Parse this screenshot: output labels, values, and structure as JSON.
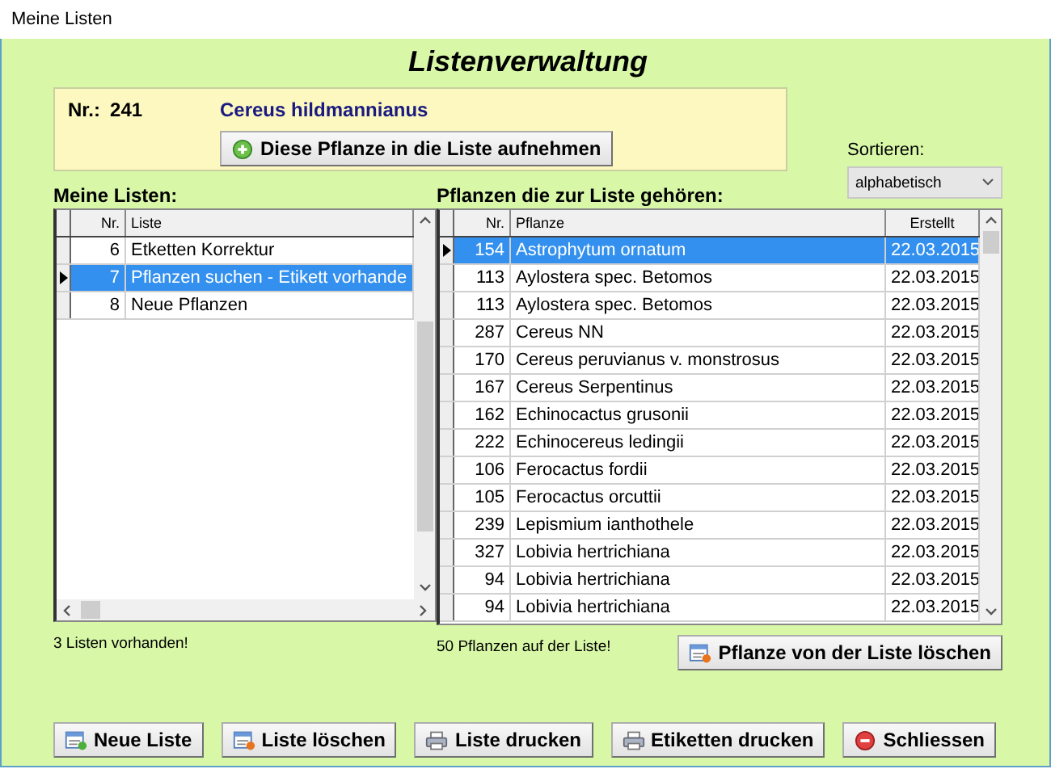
{
  "window": {
    "title": "Meine Listen"
  },
  "heading": "Listenverwaltung",
  "plant_panel": {
    "nr_label": "Nr.:",
    "nr": "241",
    "name": "Cereus hildmannianus",
    "add_button": {
      "label": "Diese Pflanze in die Liste aufnehmen",
      "kind": "add"
    }
  },
  "sort": {
    "label": "Sortieren:",
    "value": "alphabetisch"
  },
  "lists": {
    "title": "Meine Listen:",
    "columns": [
      "Nr.",
      "Liste"
    ],
    "rows": [
      {
        "nr": "6",
        "name": "Etketten Korrektur",
        "selected": false
      },
      {
        "nr": "7",
        "name": "Pflanzen suchen - Etikett vorhande",
        "selected": true
      },
      {
        "nr": "8",
        "name": "Neue Pflanzen",
        "selected": false
      }
    ],
    "status": "3 Listen vorhanden!"
  },
  "plants": {
    "title": "Pflanzen die zur Liste gehören:",
    "columns": [
      "Nr.",
      "Pflanze",
      "Erstellt"
    ],
    "rows": [
      {
        "nr": "154",
        "name": "Astrophytum ornatum",
        "date": "22.03.2015",
        "selected": true
      },
      {
        "nr": "113",
        "name": "Aylostera spec.  Betomos",
        "date": "22.03.2015",
        "selected": false
      },
      {
        "nr": "113",
        "name": "Aylostera spec.  Betomos",
        "date": "22.03.2015",
        "selected": false
      },
      {
        "nr": "287",
        "name": "Cereus NN",
        "date": "22.03.2015",
        "selected": false
      },
      {
        "nr": "170",
        "name": "Cereus peruvianus v. monstrosus",
        "date": "22.03.2015",
        "selected": false
      },
      {
        "nr": "167",
        "name": "Cereus Serpentinus",
        "date": "22.03.2015",
        "selected": false
      },
      {
        "nr": "162",
        "name": "Echinocactus grusonii",
        "date": "22.03.2015",
        "selected": false
      },
      {
        "nr": "222",
        "name": "Echinocereus ledingii",
        "date": "22.03.2015",
        "selected": false
      },
      {
        "nr": "106",
        "name": "Ferocactus fordii",
        "date": "22.03.2015",
        "selected": false
      },
      {
        "nr": "105",
        "name": "Ferocactus orcuttii",
        "date": "22.03.2015",
        "selected": false
      },
      {
        "nr": "239",
        "name": "Lepismium ianthothele",
        "date": "22.03.2015",
        "selected": false
      },
      {
        "nr": "327",
        "name": "Lobivia hertrichiana",
        "date": "22.03.2015",
        "selected": false
      },
      {
        "nr": "94",
        "name": "Lobivia hertrichiana",
        "date": "22.03.2015",
        "selected": false
      },
      {
        "nr": "94",
        "name": "Lobivia hertrichiana",
        "date": "22.03.2015",
        "selected": false
      }
    ],
    "status": "50 Pflanzen auf der Liste!",
    "remove_button": {
      "label": "Pflanze von der Liste löschen",
      "kind": "list-remove"
    }
  },
  "buttons": [
    {
      "label": "Neue Liste",
      "kind": "list-add"
    },
    {
      "label": "Liste löschen",
      "kind": "list-remove"
    },
    {
      "label": "Liste drucken",
      "kind": "print"
    },
    {
      "label": "Etiketten drucken",
      "kind": "print"
    },
    {
      "label": "Schliessen",
      "kind": "close"
    }
  ]
}
